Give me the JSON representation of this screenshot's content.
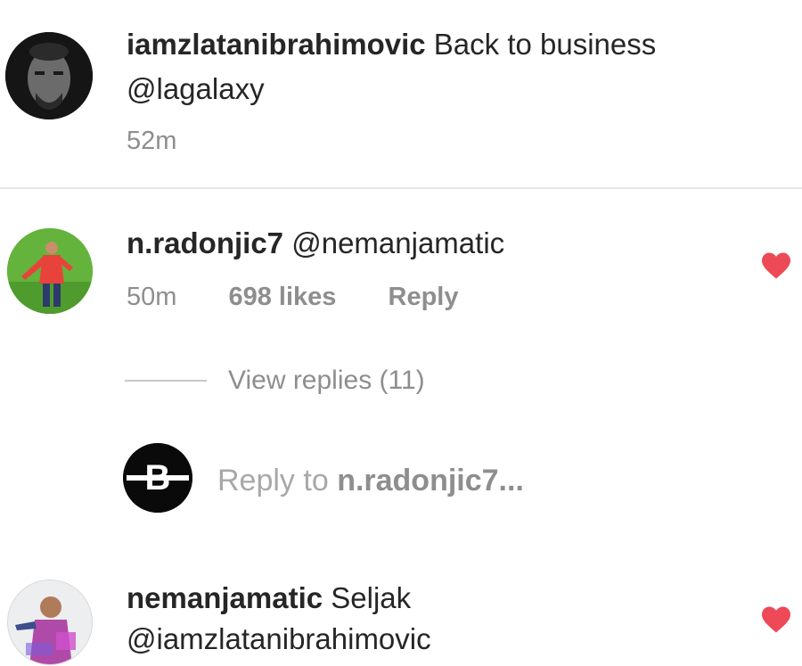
{
  "post": {
    "username": "iamzlatanibrahimovic",
    "caption": "Back to business",
    "mention": "@lagalaxy",
    "time": "52m"
  },
  "comments": [
    {
      "username": "n.radonjic7",
      "text": "@nemanjamatic",
      "time": "50m",
      "likes": "698 likes",
      "reply_label": "Reply",
      "liked": true,
      "view_replies": "View replies (11)"
    },
    {
      "username": "nemanjamatic",
      "text": "Seljak",
      "mention": "@iamzlatanibrahimovic",
      "liked": true
    }
  ],
  "reply_composer": {
    "avatar_letter": "B",
    "prompt": "Reply to",
    "target": "n.radonjic7..."
  },
  "colors": {
    "heart": "#ed4956",
    "secondary_text": "#8e8e8e",
    "primary_text": "#262626"
  },
  "icons": [
    "heart-icon"
  ]
}
